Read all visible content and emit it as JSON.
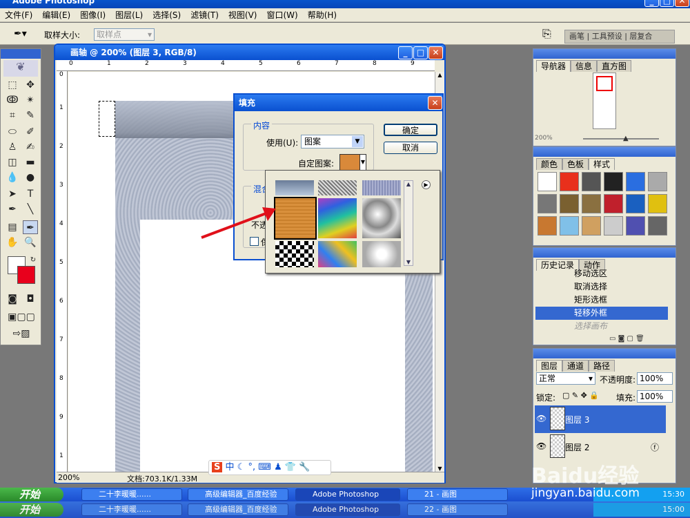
{
  "app": {
    "title": "Adobe Photoshop"
  },
  "menu": [
    "文件(F)",
    "编辑(E)",
    "图像(I)",
    "图层(L)",
    "选择(S)",
    "滤镜(T)",
    "视图(V)",
    "窗口(W)",
    "帮助(H)"
  ],
  "options": {
    "sample_label": "取样大小:",
    "sample_value": "取样点",
    "palette_tabs": [
      "画笔",
      "工具预设",
      "层复合"
    ]
  },
  "doc": {
    "title": "画轴 @ 200% (图层 3, RGB/8)",
    "zoom": "200%",
    "docsize": "文档:703.1K/1.33M",
    "ruler": [
      "0",
      "1",
      "2",
      "3",
      "4",
      "5",
      "6",
      "7",
      "8",
      "9"
    ],
    "ruler_v": [
      "0",
      "1",
      "2",
      "3",
      "4",
      "5",
      "6",
      "7",
      "8",
      "9",
      "1"
    ]
  },
  "dialog": {
    "title": "填充",
    "content_legend": "内容",
    "use_label": "使用(U):",
    "use_value": "图案",
    "custom_label": "自定图案:",
    "blend_legend": "混合",
    "opacity_label": "不透",
    "preserve_label": "保",
    "ok": "确定",
    "cancel": "取消"
  },
  "navigator": {
    "tabs": [
      "导航器",
      "信息",
      "直方图"
    ],
    "zoom": "200%"
  },
  "swatches": {
    "tabs": [
      "颜色",
      "色板",
      "样式"
    ]
  },
  "history": {
    "tabs": [
      "历史记录",
      "动作"
    ],
    "items": [
      "移动选区",
      "取消选择",
      "矩形选框",
      "轻移外框",
      "选择画布"
    ]
  },
  "layers": {
    "tabs": [
      "图层",
      "通道",
      "路径"
    ],
    "mode": "正常",
    "opacity_label": "不透明度:",
    "opacity": "100%",
    "lock_label": "锁定:",
    "fill_label": "填充:",
    "fill": "100%",
    "items": [
      "图层 3",
      "图层 2"
    ]
  },
  "ime": {
    "label": "中"
  },
  "taskbar1": {
    "start": "开始",
    "tasks": [
      "二十李暖暖......",
      "高级编辑器_百度经验",
      "Adobe Photoshop",
      "21 - 画图"
    ],
    "site": "jingyan.baidu.com",
    "time": "15:30"
  },
  "taskbar2": {
    "start": "开始",
    "tasks": [
      "二十李暖暖......",
      "高级编辑器_百度经验",
      "Adobe Photoshop",
      "22 - 画图"
    ],
    "time": "15:00"
  },
  "watermark": "Baidu经验"
}
